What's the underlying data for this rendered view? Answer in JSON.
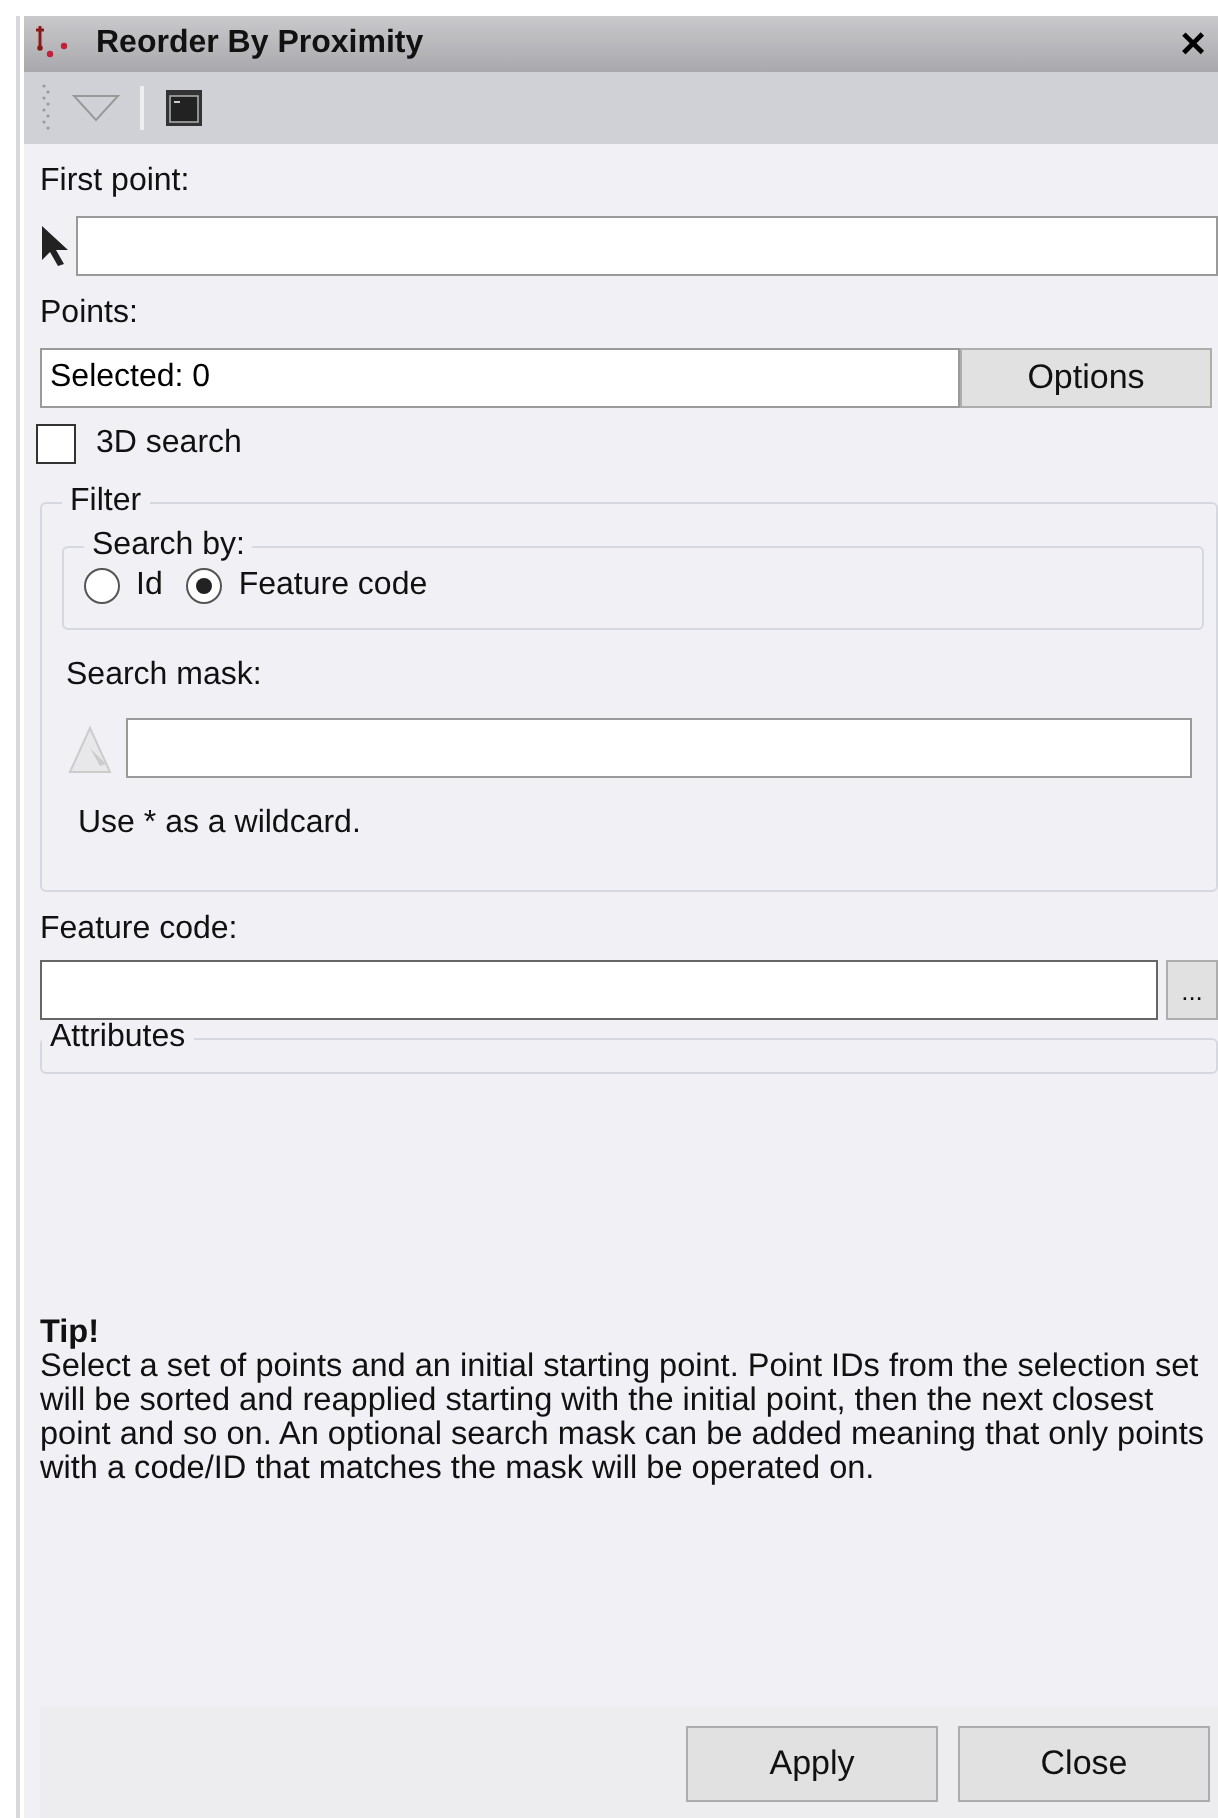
{
  "window": {
    "title": "Reorder By Proximity",
    "close": "×"
  },
  "first_point": {
    "label": "First point:"
  },
  "points": {
    "label": "Points:",
    "value": "Selected: 0",
    "button": "Options"
  },
  "search_3d": {
    "label": "3D search",
    "checked": false
  },
  "filter": {
    "title": "Filter",
    "search_by": {
      "title": "Search by:",
      "options": [
        {
          "label": "Id",
          "selected": false
        },
        {
          "label": "Feature code",
          "selected": true
        }
      ]
    },
    "mask_label": "Search mask:",
    "hint": "Use * as a wildcard."
  },
  "feature_code": {
    "label": "Feature code:",
    "button": "..."
  },
  "attributes": {
    "title": "Attributes"
  },
  "tip": {
    "title": "Tip!",
    "text": "Select a set of points and an initial starting point. Point IDs from the selection set will be sorted and reapplied starting with the initial point, then the next closest point and so on. An optional search mask can be added meaning that only points with a code/ID that matches the mask will be operated on."
  },
  "buttons": [
    "Apply",
    "Close"
  ]
}
